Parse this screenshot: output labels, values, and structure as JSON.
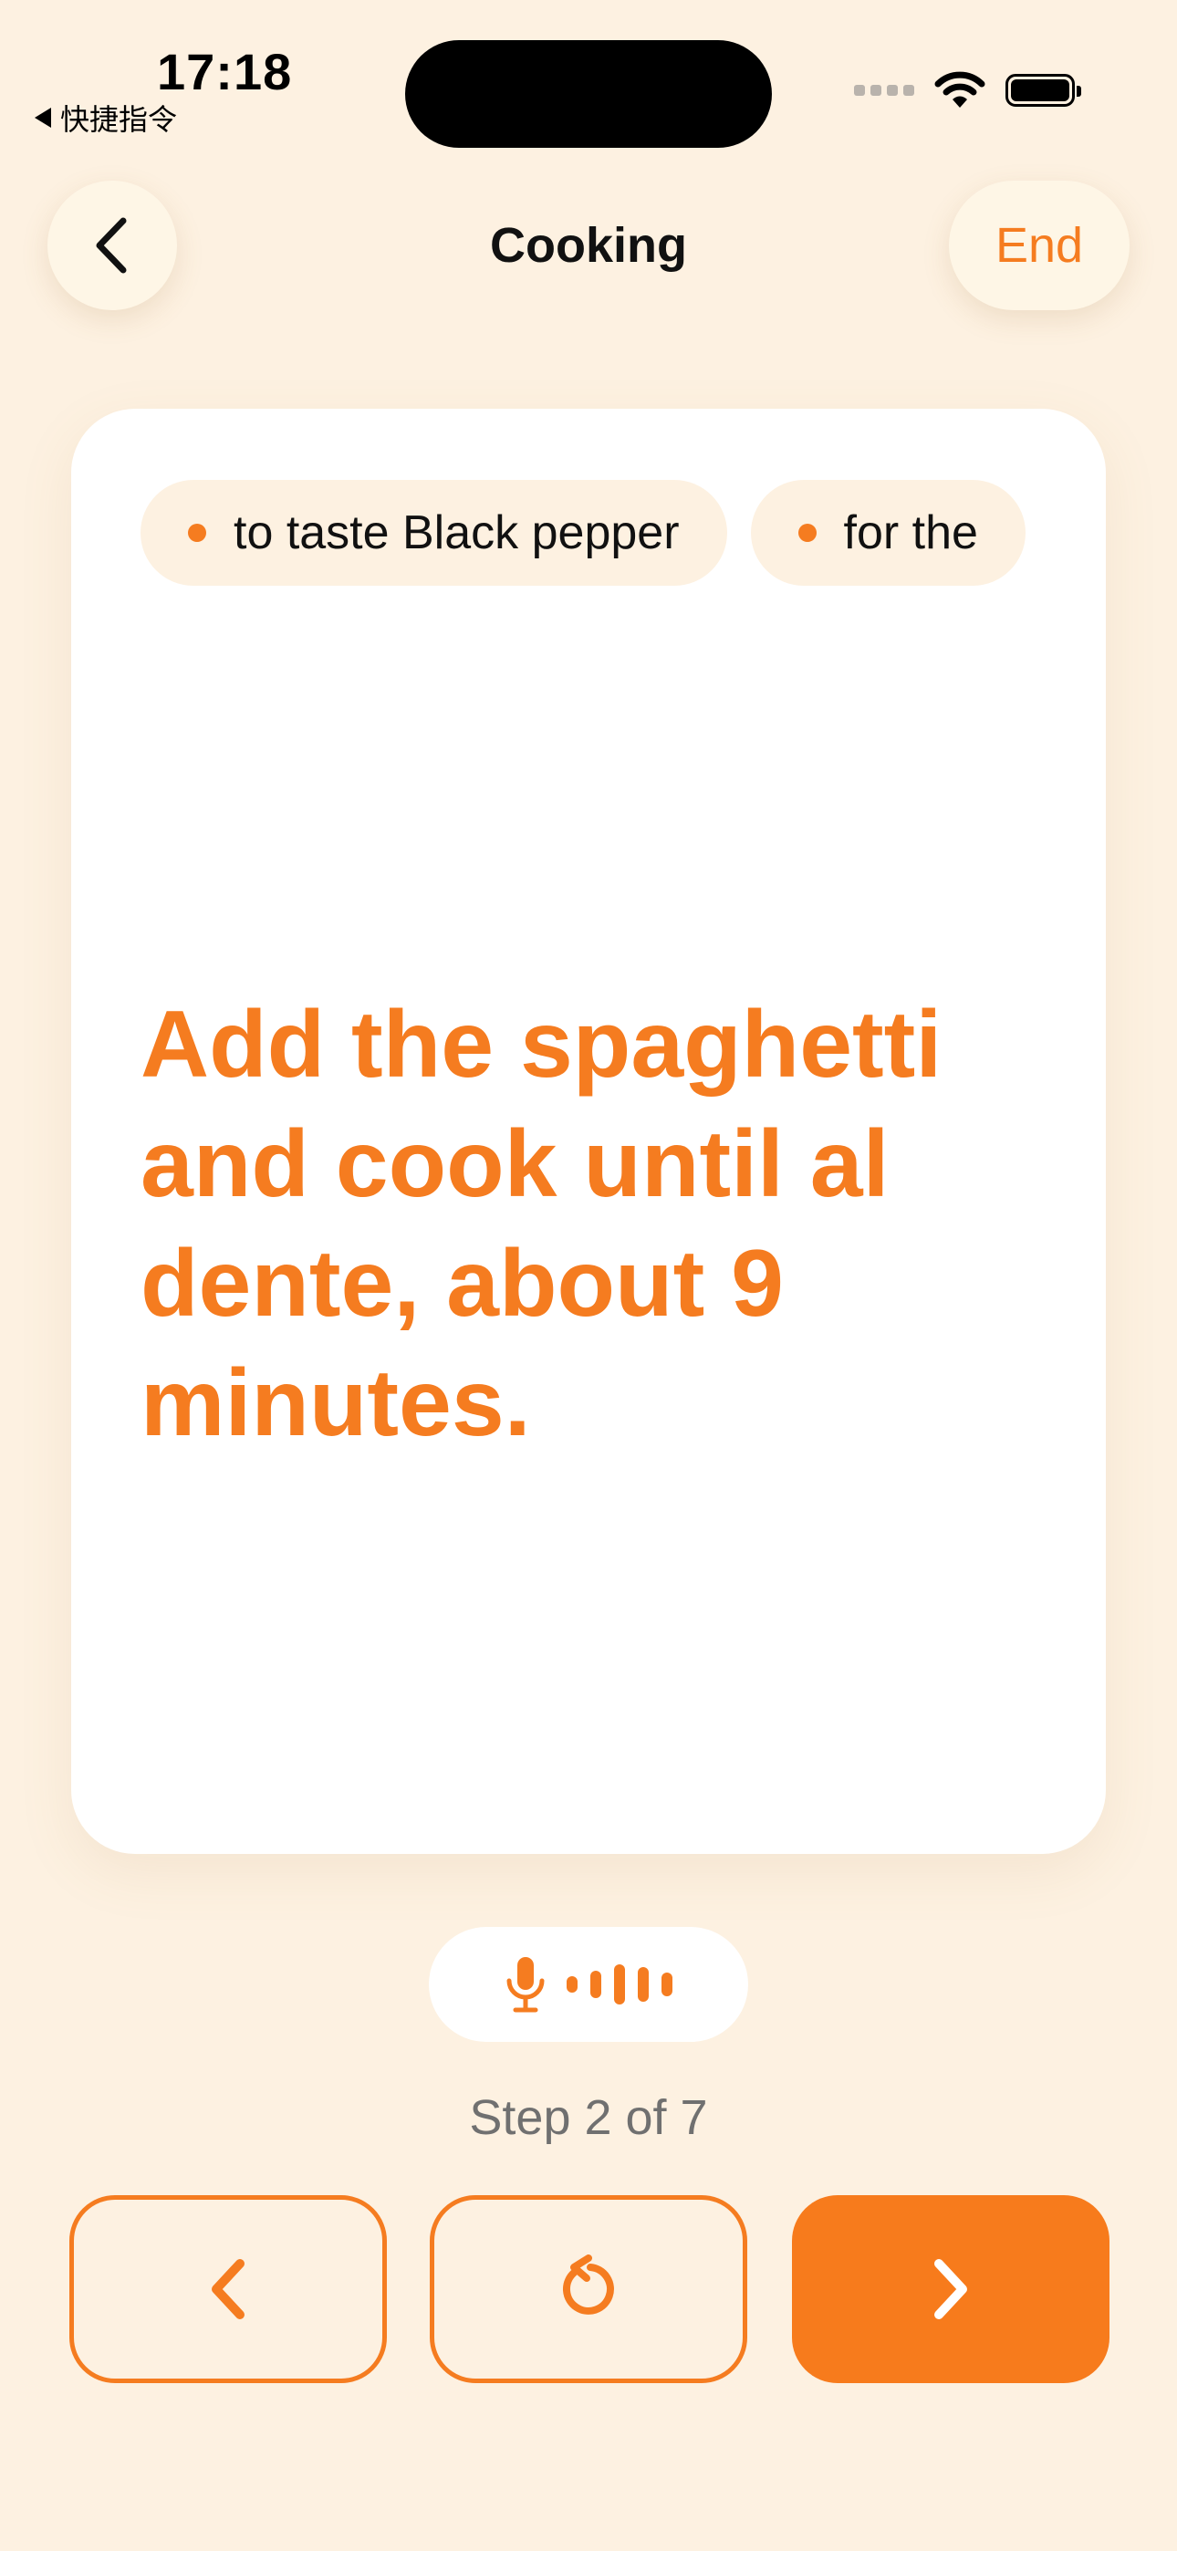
{
  "status_bar": {
    "time": "17:18",
    "back_app": "快捷指令"
  },
  "header": {
    "title": "Cooking",
    "end_label": "End"
  },
  "card": {
    "ingredients": [
      {
        "text": "to taste Black pepper"
      },
      {
        "text": "for the"
      }
    ],
    "step_text": "Add the spaghetti and cook until al dente, about 9 minutes."
  },
  "progress": {
    "current_step": 2,
    "total_steps": 7,
    "label": "Step 2 of 7"
  },
  "colors": {
    "accent": "#F57C20",
    "background": "#FDF1E1",
    "card": "#FFFFFF",
    "muted_text": "#707070"
  },
  "icons": {
    "back": "chevron-left-icon",
    "mic": "microphone-icon",
    "waveform": "waveform-icon",
    "previous": "chevron-left-icon",
    "repeat": "rotate-ccw-icon",
    "next": "chevron-right-icon"
  }
}
